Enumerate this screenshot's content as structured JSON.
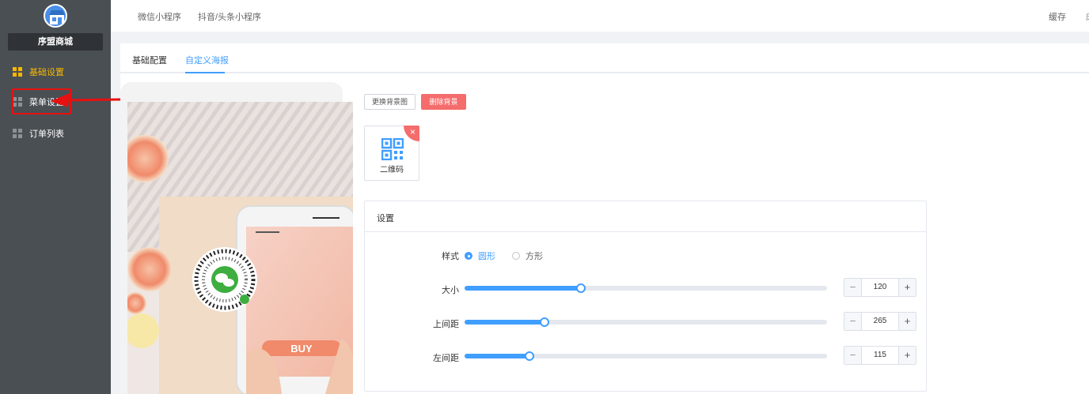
{
  "sidebar": {
    "shop_name": "序盟商城",
    "items": [
      {
        "label": "基础设置",
        "active": true
      },
      {
        "label": "菜单设置",
        "active": false
      },
      {
        "label": "订单列表",
        "active": false
      }
    ]
  },
  "topbar": {
    "tabs": [
      "微信小程序",
      "抖音/头条小程序"
    ],
    "cache_label": "缓存",
    "edge_text": "床"
  },
  "subtabs": [
    {
      "label": "基础配置",
      "active": false
    },
    {
      "label": "自定义海报",
      "active": true
    }
  ],
  "preview": {
    "buy_text": "BUY"
  },
  "buttons": {
    "change_bg": "更换背景图",
    "delete_bg": "删除背景"
  },
  "qr_tile": {
    "label": "二维码",
    "close_icon": "×"
  },
  "settings": {
    "title": "设置",
    "style_label": "样式",
    "style_options": [
      {
        "label": "圆形",
        "checked": true
      },
      {
        "label": "方形",
        "checked": false
      }
    ],
    "sliders": [
      {
        "label": "大小",
        "value": "120",
        "fraction": 0.32
      },
      {
        "label": "上间距",
        "value": "265",
        "fraction": 0.22
      },
      {
        "label": "左间距",
        "value": "115",
        "fraction": 0.18
      }
    ],
    "minus": "−",
    "plus": "+"
  },
  "colors": {
    "sidebar_bg": "#4a4f54",
    "active_nav": "#f5b800",
    "accent": "#409eff",
    "danger": "#f56c6c",
    "highlight": "#e81010"
  }
}
